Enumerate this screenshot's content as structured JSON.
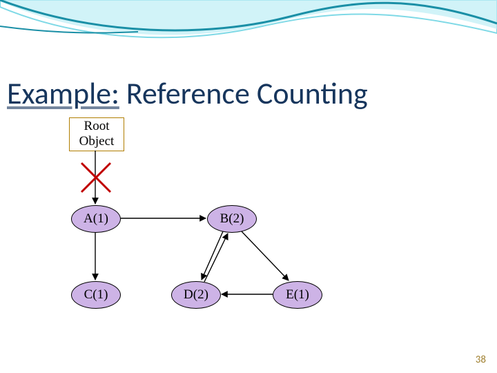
{
  "title_underlined": "Example:",
  "title_rest": " Reference Counting",
  "root_label_line1": "Root",
  "root_label_line2": "Object",
  "nodes": {
    "A": "A(1)",
    "B": "B(2)",
    "C": "C(1)",
    "D": "D(2)",
    "E": "E(1)"
  },
  "page_number": "38",
  "colors": {
    "title": "#17365d",
    "node_fill": "#cdb3e6",
    "wave_dark": "#1a8fa6",
    "wave_light": "#7fd9e6",
    "cross": "#c00000"
  }
}
